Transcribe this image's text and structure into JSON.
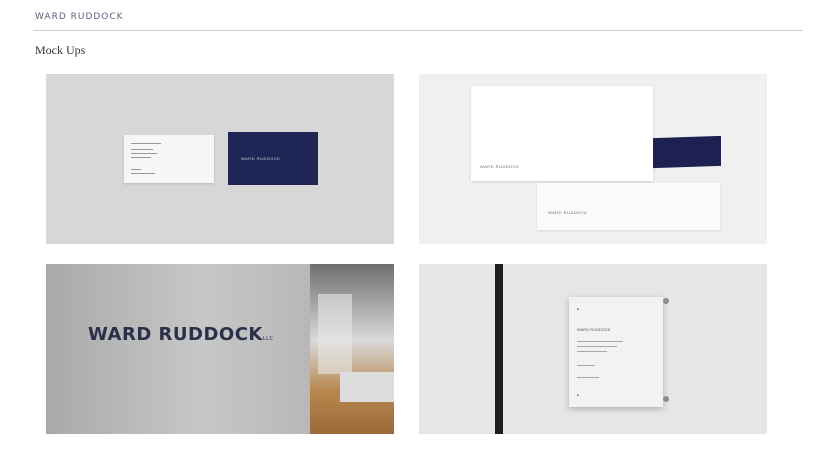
{
  "header": {
    "brand": "WARD RUDDOCK"
  },
  "section": {
    "title": "Mock Ups"
  },
  "mockups": {
    "cards": {
      "white_card_text": "",
      "navy_card_text": "WARD RUDDOCK"
    },
    "envelopes": {
      "big_text": "WARD RUDDOCK",
      "small_text": "WARD RUDDOCK"
    },
    "wall": {
      "logo": "WARD RUDDOCK",
      "logo_suffix": "LLC"
    },
    "plaque": {
      "line1": "WARD RUDDOCK"
    }
  }
}
